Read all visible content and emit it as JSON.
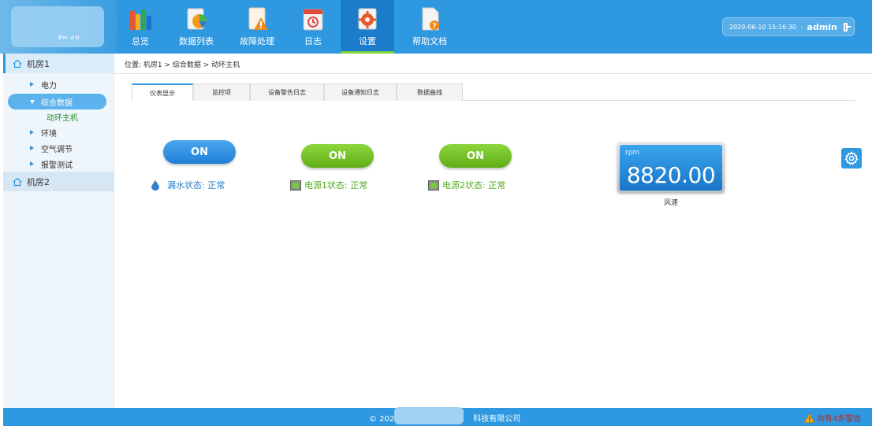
{
  "logo": {
    "text": "BH          AN"
  },
  "nav": [
    {
      "label": "总览",
      "icon": "books-icon"
    },
    {
      "label": "数据列表",
      "icon": "chart-list-icon"
    },
    {
      "label": "故障处理",
      "icon": "warning-doc-icon"
    },
    {
      "label": "日志",
      "icon": "calendar-log-icon"
    },
    {
      "label": "设置",
      "icon": "settings-gear-icon",
      "active": true
    },
    {
      "label": "帮助文档",
      "icon": "help-doc-icon"
    }
  ],
  "user": {
    "datetime": "2020-06-10 15:16:30",
    "name": "admin"
  },
  "sidebar": {
    "room1": "机房1",
    "items": [
      "电力",
      "综合数据",
      "环境",
      "空气调节",
      "报警测试"
    ],
    "sub_item": "动环主机",
    "room2": "机房2"
  },
  "breadcrumb": "位置: 机房1 > 综合数据 > 动环主机",
  "tabs": [
    "仪表显示",
    "监控项",
    "设备警告日志",
    "设备通知日志",
    "数据曲线"
  ],
  "toggles": [
    "ON",
    "ON",
    "ON"
  ],
  "statuses": [
    "漏水状态: 正常",
    "电源1状态: 正常",
    "电源2状态: 正常"
  ],
  "gauge": {
    "unit": "rpm",
    "value": "8820.00",
    "label": "风速"
  },
  "footer": {
    "copyright": "© 202",
    "copyright_tail": "科技有限公司",
    "warning": "共有4条警告"
  },
  "colors": {
    "primary": "#2e98e0",
    "active_nav": "#1b7ccc",
    "green": "#6ec024",
    "warning": "#c0261e"
  }
}
